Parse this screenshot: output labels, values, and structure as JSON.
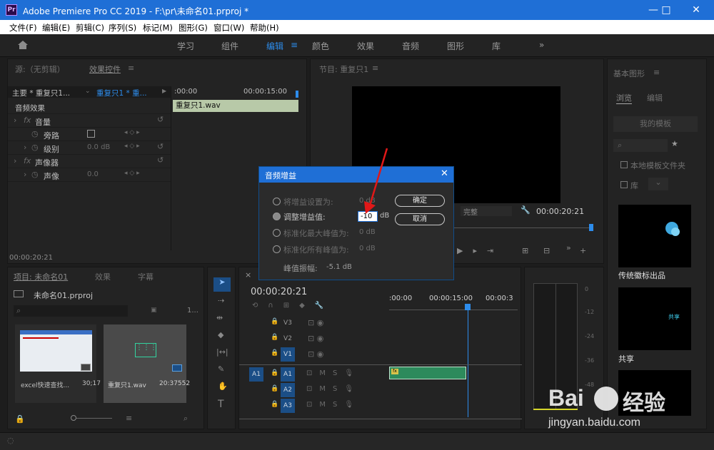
{
  "window": {
    "title": "Adobe Premiere Pro CC 2019 - F:\\pr\\未命名01.prproj *",
    "logo": "Pr"
  },
  "menu": [
    "文件(F)",
    "编辑(E)",
    "剪辑(C)",
    "序列(S)",
    "标记(M)",
    "图形(G)",
    "窗口(W)",
    "帮助(H)"
  ],
  "workspaces": [
    "学习",
    "组件",
    "编辑",
    "颜色",
    "效果",
    "音频",
    "图形",
    "库"
  ],
  "active_workspace": "编辑",
  "source": {
    "tab": "源:（无剪辑）",
    "active_tab": "效果控件",
    "master": "主要 * 重复只1...",
    "sequence": "重复只1 * 重...",
    "t0": ":00:00",
    "t1": "00:00:15:00",
    "clip": "重复只1.wav",
    "section": "音频效果",
    "effects": [
      {
        "name": "音量",
        "kind": "fx"
      },
      {
        "name": "旁路",
        "kind": "param",
        "value": ""
      },
      {
        "name": "级别",
        "kind": "param",
        "value": "0.0 dB"
      },
      {
        "name": "声像器",
        "kind": "fx"
      },
      {
        "name": "声像",
        "kind": "param",
        "value": "0.0"
      }
    ],
    "timecode": "00:00:20:21"
  },
  "program": {
    "tab": "节目: 重复只1",
    "fit": "完整",
    "timecode": "00:00:20:21"
  },
  "dialog": {
    "title": "音频增益",
    "options": [
      {
        "label": "将增益设置为:",
        "value": "0 dB",
        "on": false
      },
      {
        "label": "调整增益值:",
        "value": "-10",
        "unit": "dB",
        "on": true
      },
      {
        "label": "标准化最大峰值为:",
        "value": "0 dB",
        "on": false
      },
      {
        "label": "标准化所有峰值为:",
        "value": "0 dB",
        "on": false
      }
    ],
    "peak_label": "峰值振幅:",
    "peak_value": "-5.1 dB",
    "ok": "确定",
    "cancel": "取消"
  },
  "project": {
    "tabs": [
      "项目: 未命名01",
      "效果",
      "字幕"
    ],
    "file": "未命名01.prproj",
    "count": "1...",
    "items": [
      {
        "name": "excel快速查找...",
        "dur": "30;17"
      },
      {
        "name": "重复只1.wav",
        "dur": "20:37552"
      }
    ]
  },
  "timeline": {
    "timecode": "00:00:20:21",
    "t0": ":00:00",
    "t1": "00:00:15:00",
    "t2": "00:00:3",
    "video": [
      "V3",
      "V2",
      "V1"
    ],
    "audio": [
      "A1",
      "A2",
      "A3"
    ],
    "src_patch": "A1"
  },
  "meter": {
    "scale": [
      "0",
      "-12",
      "-24",
      "-36",
      "-48"
    ]
  },
  "graphics": {
    "title": "基本图形",
    "tabs": [
      "浏览",
      "编辑"
    ],
    "my_templates": "我的模板",
    "local": "本地模板文件夹",
    "lib": "库",
    "items": [
      {
        "name": "传统徽标出品",
        "caption": ""
      },
      {
        "name": "共享",
        "caption": "共享"
      }
    ]
  },
  "watermark": {
    "brand": "Bai",
    "brand2": "经验",
    "url": "jingyan.baidu.com"
  },
  "colors": {
    "accent": "#2d8ceb",
    "titlebar": "#1f6fd6",
    "arrow": "#e01818",
    "clip": "#2d8a5c"
  }
}
